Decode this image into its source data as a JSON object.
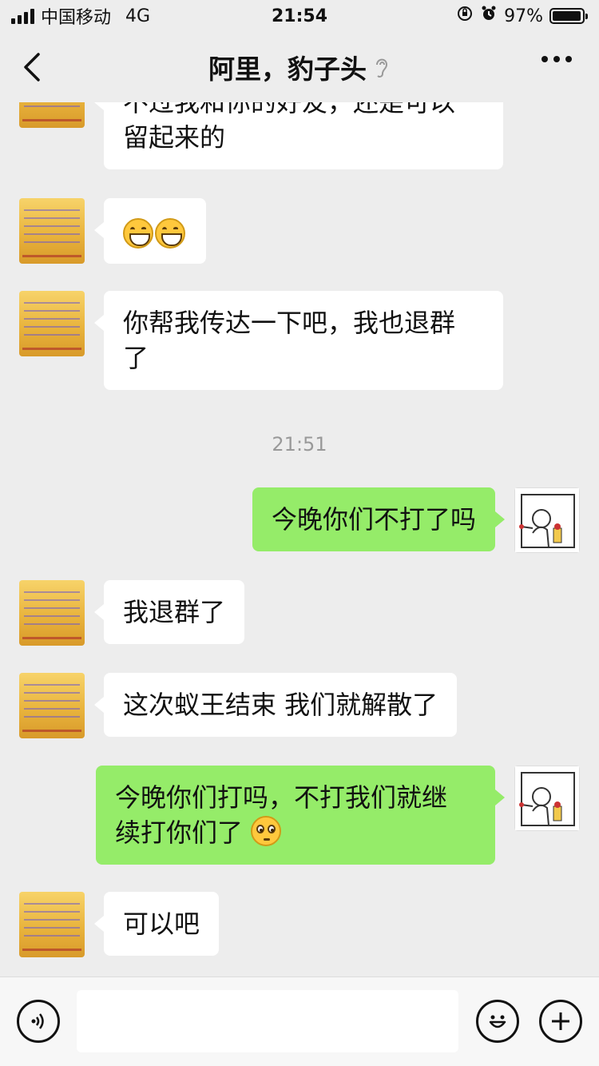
{
  "status_bar": {
    "carrier": "中国移动",
    "network": "4G",
    "time": "21:54",
    "battery": "97%",
    "battery_level": 0.97
  },
  "header": {
    "title": "阿里，豹子头",
    "back_icon": "chevron-left-icon",
    "title_icon": "ear-icon",
    "more_icon": "more-dots-icon"
  },
  "messages": [
    {
      "side": "left",
      "text_line1": "不过我和你的好友，还是可以",
      "text_line2": "留起来的"
    },
    {
      "side": "left",
      "emoji": "grin-emoji x2"
    },
    {
      "side": "left",
      "text_line1": "你帮我传达一下吧，我也退群",
      "text_line2": "了"
    },
    {
      "type": "time",
      "text": "21:51"
    },
    {
      "side": "right",
      "text": "今晚你们不打了吗"
    },
    {
      "side": "left",
      "text": "我退群了"
    },
    {
      "side": "left",
      "text": "这次蚁王结束 我们就解散了"
    },
    {
      "side": "right",
      "text_line1": "今晚你们打吗，不打我们就继",
      "text_line2": "续打你们了"
    },
    {
      "side": "left",
      "text": "可以吧"
    }
  ],
  "input_bar": {
    "voice_icon": "voice-icon",
    "emoji_icon": "emoji-icon",
    "plus_icon": "plus-icon",
    "value": ""
  },
  "colors": {
    "background": "#ededed",
    "incoming_bubble": "#ffffff",
    "outgoing_bubble": "#95ec69",
    "timestamp": "#999999"
  }
}
